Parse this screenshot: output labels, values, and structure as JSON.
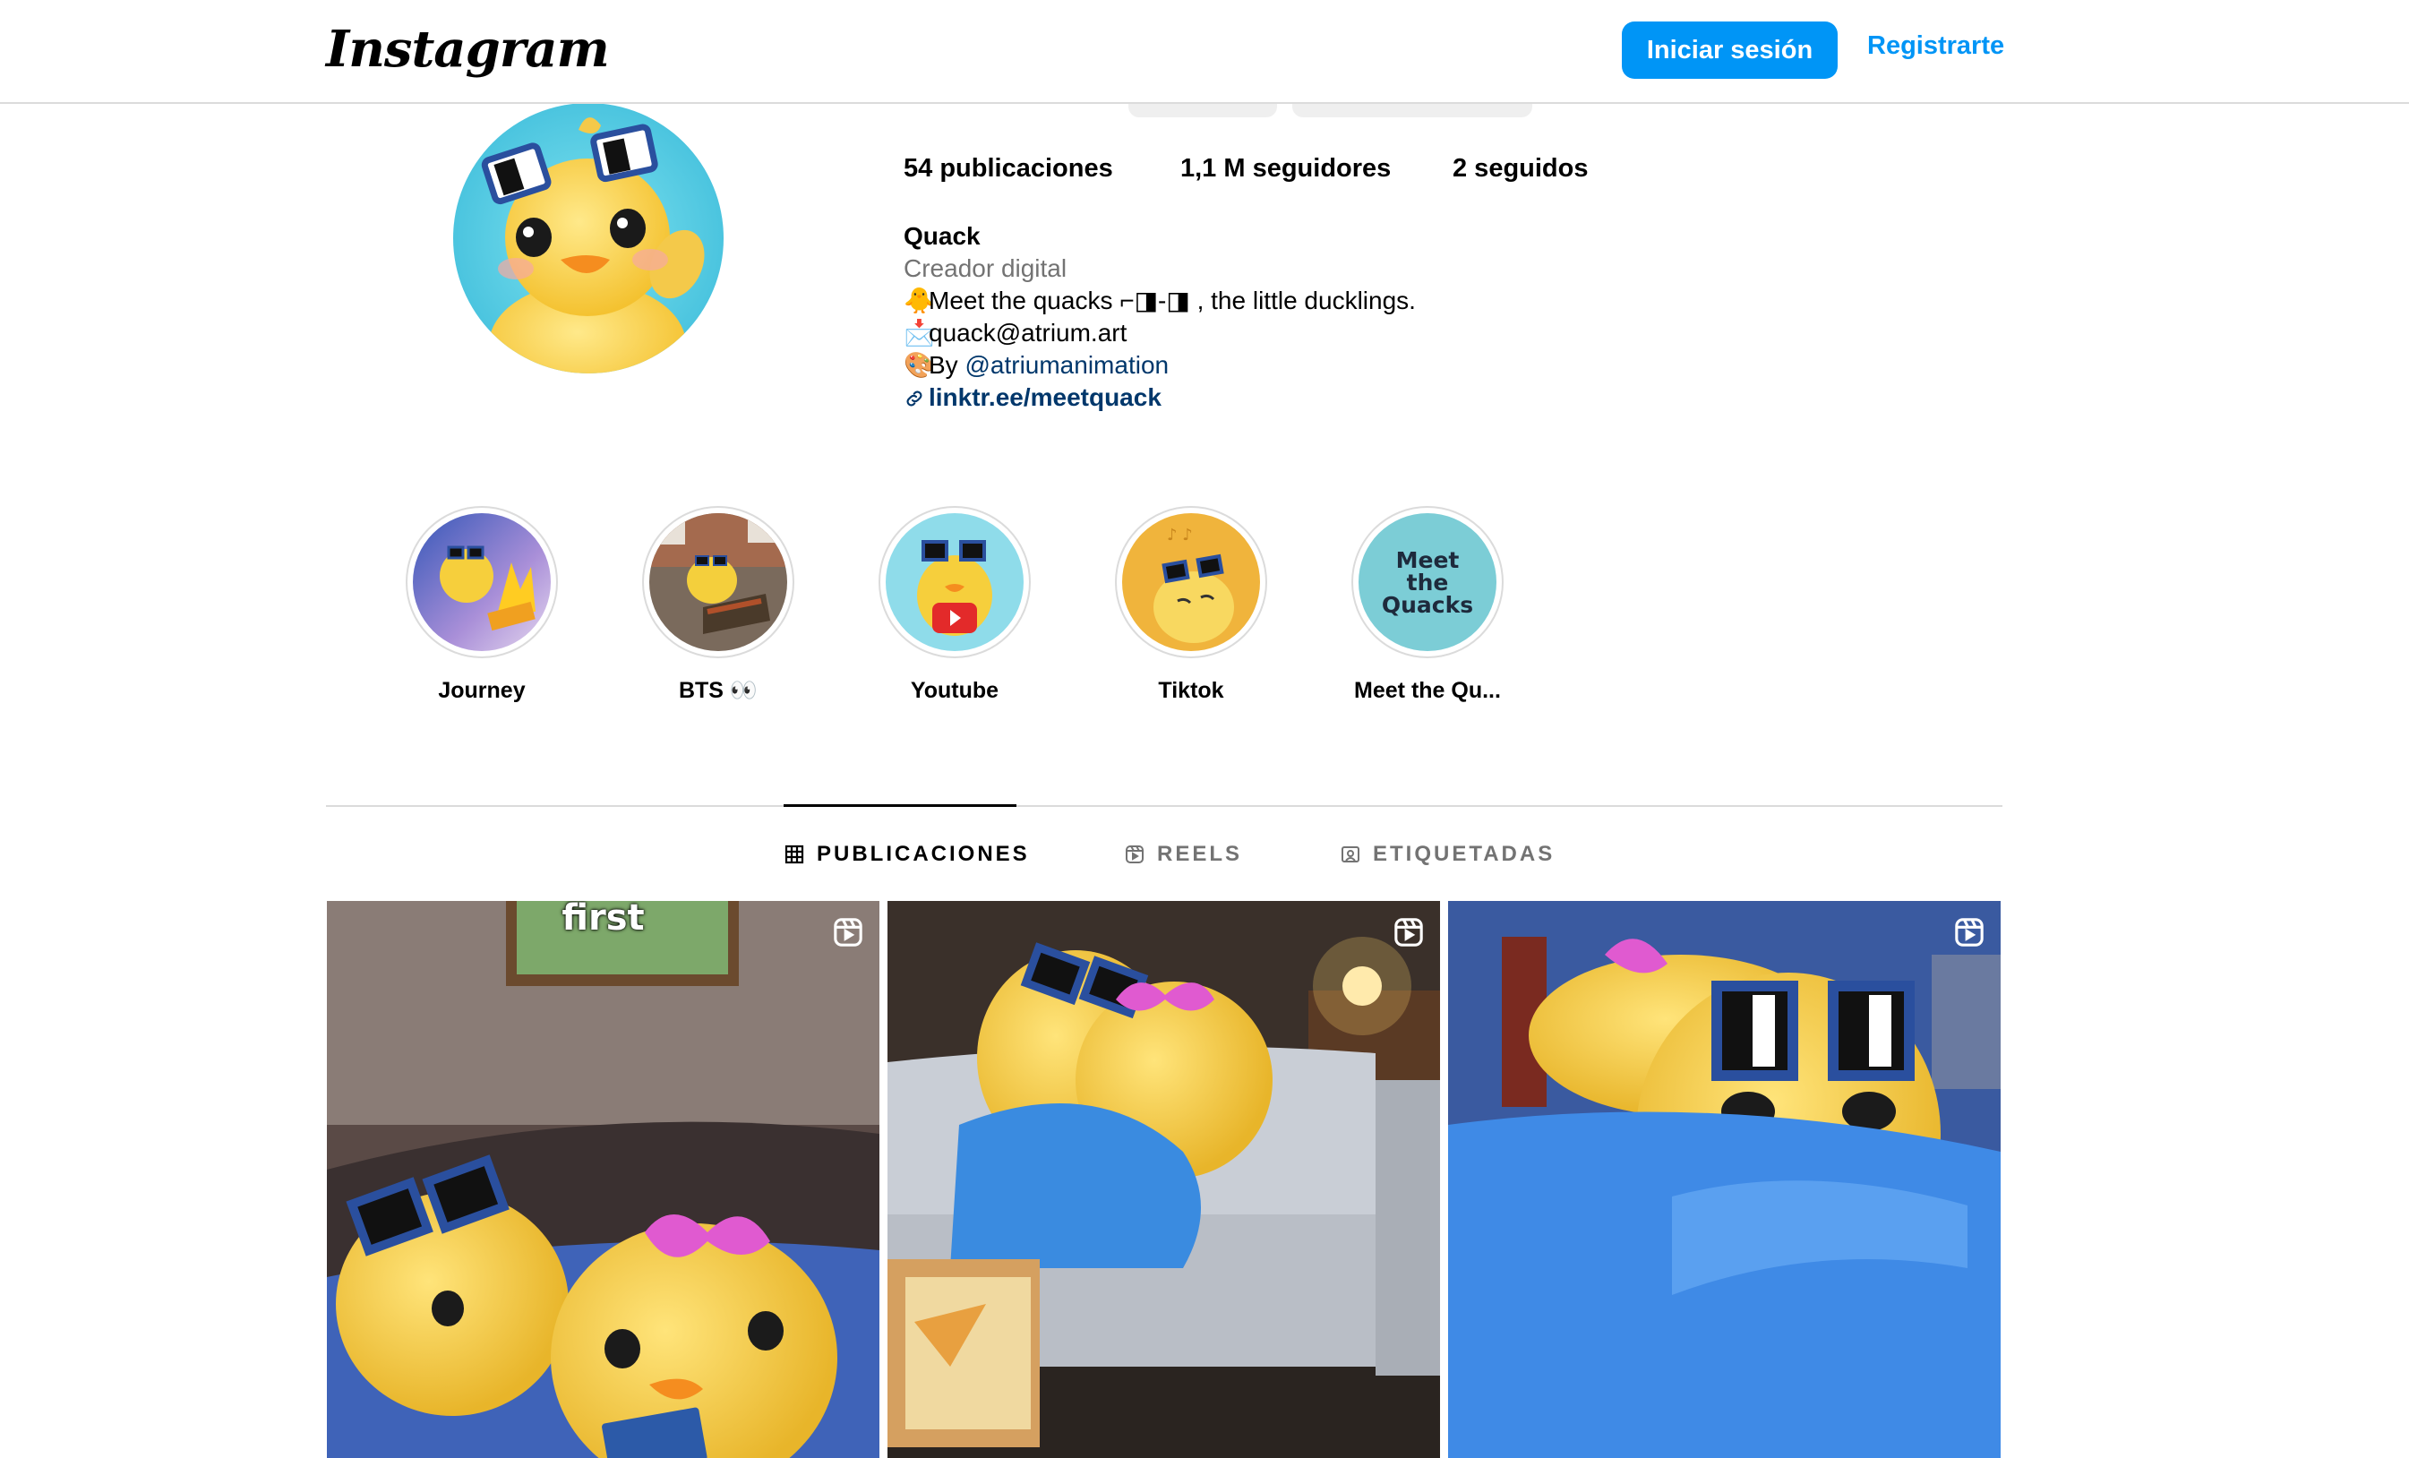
{
  "header": {
    "logo_text": "Instagram",
    "login_label": "Iniciar sesión",
    "register_label": "Registrarte",
    "accent_color": "#0095f6"
  },
  "profile": {
    "stats": {
      "posts": "54 publicaciones",
      "followers": "1,1 M seguidores",
      "following": "2 seguidos"
    },
    "name": "Quack",
    "category": "Creador digital",
    "bio": {
      "line1_emoji": "🐥",
      "line1_text": "Meet the quacks ⌐◨-◨ , the little ducklings.",
      "line2_emoji": "📩",
      "line2_text": "quack@atrium.art",
      "line3_emoji": "🎨",
      "line3_prefix": "By",
      "line3_mention": "@atriumanimation",
      "link_text": "linktr.ee/meetquack"
    }
  },
  "highlights": [
    {
      "label": "Journey"
    },
    {
      "label": "BTS 👀"
    },
    {
      "label": "Youtube"
    },
    {
      "label": "Tiktok"
    },
    {
      "label": "Meet the Qu..."
    }
  ],
  "highlight_cover_text": [
    "Meet",
    "the",
    "Quacks"
  ],
  "tabs": [
    {
      "label": "PUBLICACIONES",
      "icon": "grid-icon",
      "active": true
    },
    {
      "label": "REELS",
      "icon": "reels-icon",
      "active": false
    },
    {
      "label": "ETIQUETADAS",
      "icon": "tagged-icon",
      "active": false
    }
  ],
  "posts": [
    {
      "overlay_text": "first",
      "type": "reel"
    },
    {
      "overlay_text": "",
      "type": "reel"
    },
    {
      "overlay_text": "",
      "type": "reel"
    }
  ]
}
